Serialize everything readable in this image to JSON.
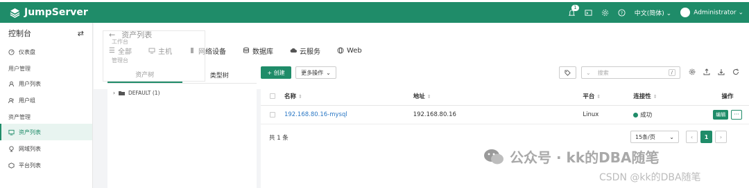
{
  "app": {
    "name": "JumpServer"
  },
  "topbar": {
    "notification_count": "1",
    "language": "中文(简体)",
    "user": "Administrator"
  },
  "sidebar": {
    "title": "控制台",
    "items": [
      {
        "label": "仪表盘",
        "icon": "dashboard-icon"
      },
      {
        "group": "用户管理"
      },
      {
        "label": "用户列表",
        "icon": "user-icon"
      },
      {
        "label": "用户组",
        "icon": "user-group-icon"
      },
      {
        "group": "资产管理"
      },
      {
        "label": "资产列表",
        "icon": "asset-icon",
        "active": true
      },
      {
        "label": "网域列表",
        "icon": "domain-icon"
      },
      {
        "label": "平台列表",
        "icon": "platform-icon"
      }
    ]
  },
  "page": {
    "title": "资产列表",
    "tabs": [
      "全部",
      "主机",
      "网络设备",
      "数据库",
      "云服务",
      "Web"
    ],
    "ghost": {
      "line1": "工作台",
      "line2": "管理台"
    }
  },
  "tree": {
    "tabs": [
      "资产树",
      "类型树"
    ],
    "node": "DEFAULT (1)"
  },
  "toolbar": {
    "create": "创建",
    "more": "更多操作",
    "search_placeholder": "搜索",
    "slash": "/"
  },
  "table": {
    "columns": [
      "名称",
      "地址",
      "平台",
      "连接性",
      "操作"
    ],
    "rows": [
      {
        "name": "192.168.80.16-mysql",
        "address": "192.168.80.16",
        "platform": "Linux",
        "connectivity": "成功",
        "edit": "编辑",
        "more": "···"
      }
    ]
  },
  "footer": {
    "total": "共 1 条",
    "page_size": "15条/页",
    "current_page": "1"
  },
  "watermarks": {
    "wechat": "公众号 · kk的DBA随笔",
    "csdn": "CSDN @kk的DBA随笔"
  },
  "colors": {
    "brand": "#1f8c69",
    "link": "#2b78c5"
  }
}
